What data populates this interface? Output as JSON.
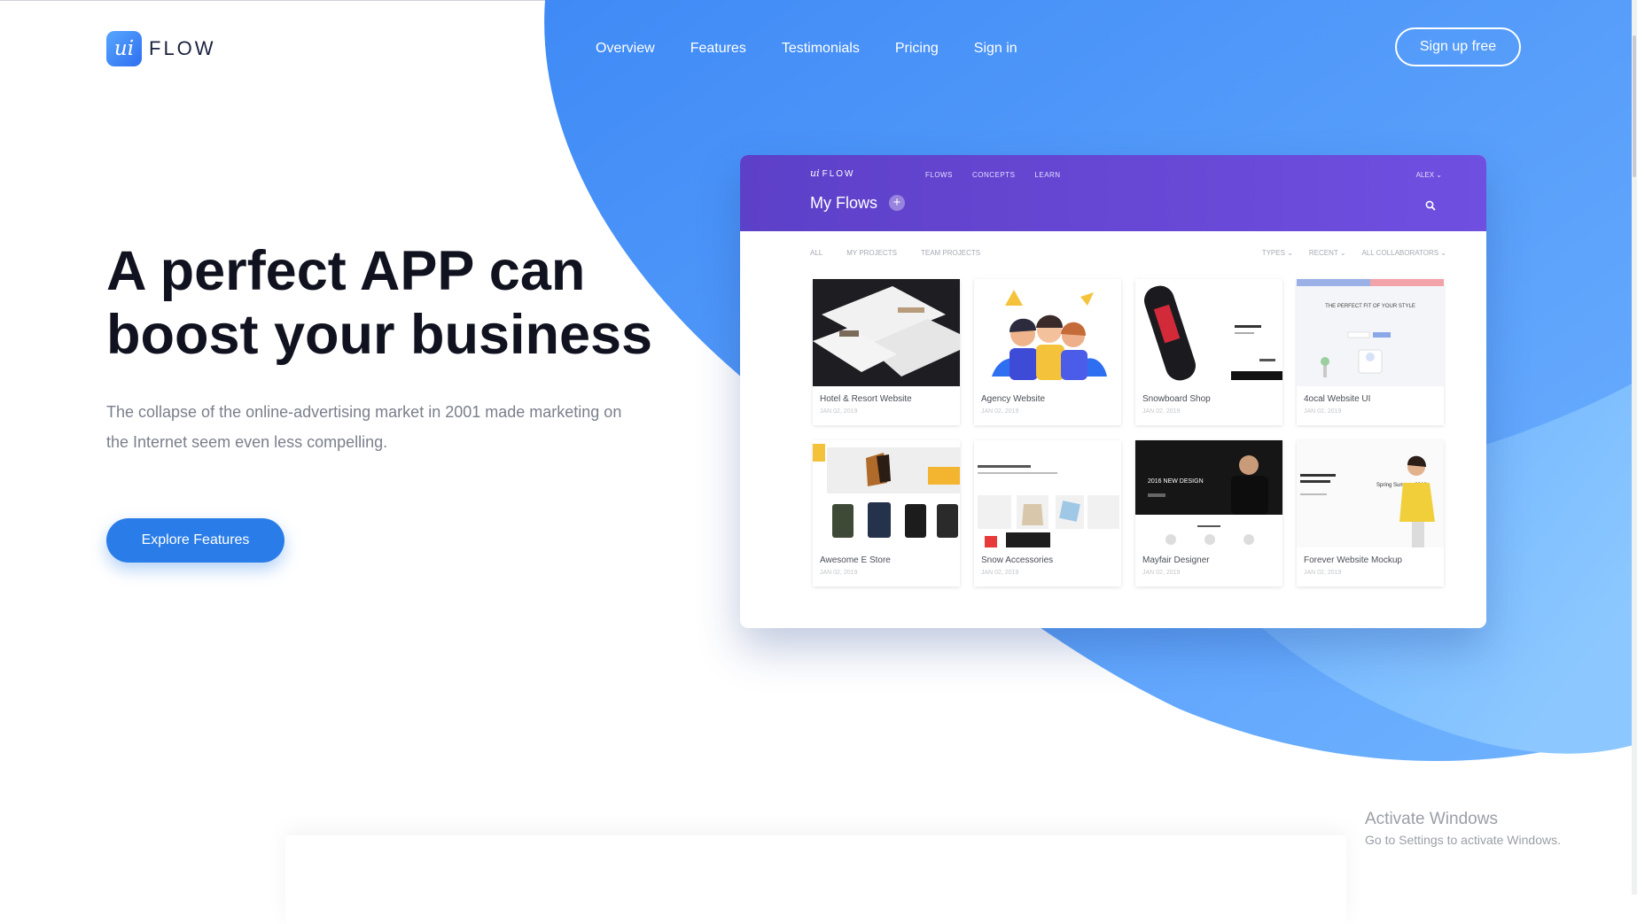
{
  "brand": {
    "mark": "ui",
    "name": "FLOW"
  },
  "nav": [
    "Overview",
    "Features",
    "Testimonials",
    "Pricing",
    "Sign in"
  ],
  "signup_label": "Sign up free",
  "hero": {
    "title": "A perfect APP can\nboost your business",
    "subtitle": "The collapse of the online-advertising market in 2001 made marketing on the Internet seem even less compelling.",
    "cta": "Explore Features"
  },
  "mockup": {
    "logo_mark": "ui",
    "logo_text": "FLOW",
    "nav": [
      "FLOWS",
      "CONCEPTS",
      "LEARN"
    ],
    "user": "ALEX ⌄",
    "title": "My Flows",
    "add_symbol": "+",
    "filters": [
      "ALL",
      "MY PROJECTS",
      "TEAM PROJECTS"
    ],
    "sorts": [
      "TYPES ⌄",
      "RECENT ⌄",
      "ALL COLLABORATORS ⌄"
    ],
    "cards": [
      {
        "name": "Hotel & Resort Website",
        "date": "JAN 02, 2019"
      },
      {
        "name": "Agency Website",
        "date": "JAN 02, 2019"
      },
      {
        "name": "Snowboard Shop",
        "date": "JAN 02, 2019"
      },
      {
        "name": "4ocal Website UI",
        "date": "JAN 02, 2019"
      },
      {
        "name": "Awesome E Store",
        "date": "JAN 02, 2019"
      },
      {
        "name": "Snow Accessories",
        "date": "JAN 02, 2019"
      },
      {
        "name": "Mayfair Designer",
        "date": "JAN 02, 2019"
      },
      {
        "name": "Forever Website Mockup",
        "date": "JAN 02, 2019"
      }
    ],
    "thumb_text": {
      "perfect_fit": "THE PERFECT FIT OF YOUR STYLE",
      "collection": "2016 NEW DESIGN",
      "spring": "Spring Summer 2016"
    }
  },
  "windows_notice": {
    "title": "Activate Windows",
    "subtitle": "Go to Settings to activate Windows."
  },
  "colors": {
    "accent_blue": "#2a7de8",
    "mock_header": "#5d40c8",
    "blob_blue": "#4f95f8"
  }
}
